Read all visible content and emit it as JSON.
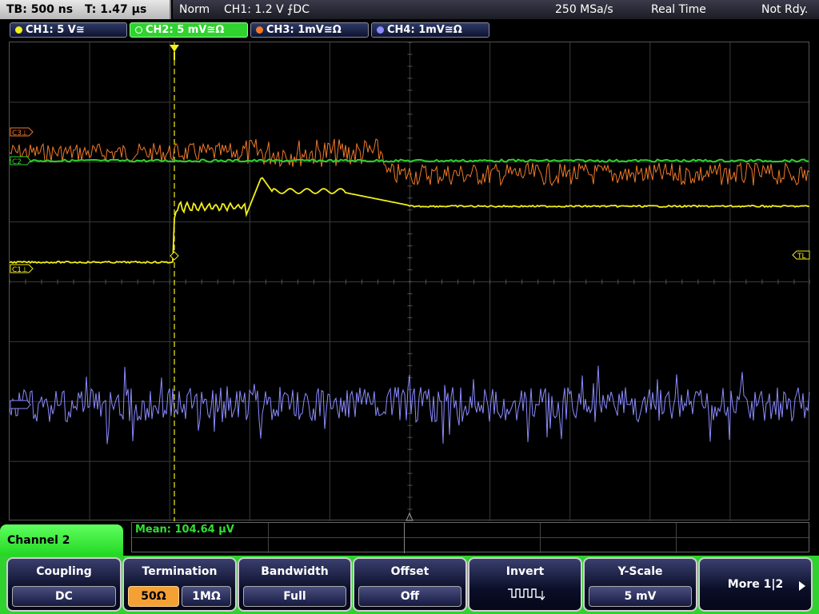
{
  "topbar": {
    "timebase": "TB: 500 ns",
    "trigger_time": "T: 1.47 µs",
    "mode": "Norm",
    "trigger_info": "CH1: 1.2 V ⨍DC",
    "sample_rate": "250 MSa/s",
    "acquisition": "Real Time",
    "status": "Not Rdy."
  },
  "channels": [
    {
      "label": "CH1: 5 V≅",
      "color": "#f2ef1a",
      "active": false
    },
    {
      "label": "CH2: 5 mV≅Ω",
      "color": "#2fd22f",
      "active": true
    },
    {
      "label": "CH3: 1mV≅Ω",
      "color": "#f07a2a",
      "active": false
    },
    {
      "label": "CH4: 1mV≅Ω",
      "color": "#8b8bff",
      "active": false
    }
  ],
  "markers": {
    "c3": "C3⊥",
    "c2": "C2",
    "c1": "C1⊥",
    "tl": "TL",
    "trigger": "T"
  },
  "info": {
    "channel_title": "Channel 2",
    "mean": "Mean: 104.64 µV"
  },
  "menu": {
    "coupling": {
      "title": "Coupling",
      "value": "DC"
    },
    "termination": {
      "title": "Termination",
      "opt1": "50Ω",
      "opt2": "1MΩ"
    },
    "bandwidth": {
      "title": "Bandwidth",
      "value": "Full"
    },
    "offset": {
      "title": "Offset",
      "value": "Off"
    },
    "invert": {
      "title": "Invert"
    },
    "yscale": {
      "title": "Y-Scale",
      "value": "5 mV"
    },
    "more": {
      "label": "More 1|2"
    }
  },
  "colors": {
    "ch1": "#f2ef1a",
    "ch2": "#2fd22f",
    "ch3": "#f07a2a",
    "ch4": "#8b8bff",
    "grid": "#3a3a3a",
    "menu_bg": "#2fd22f"
  }
}
